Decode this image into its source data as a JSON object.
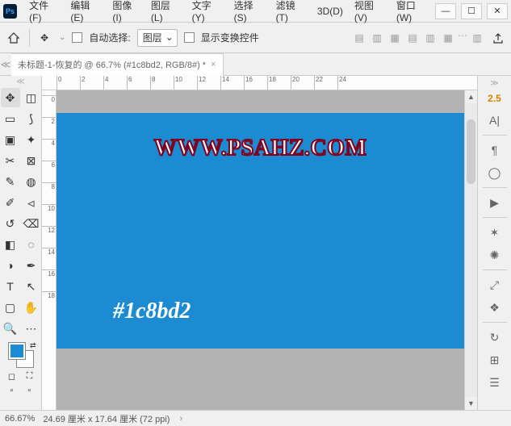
{
  "menubar": {
    "items": [
      "文件(F)",
      "编辑(E)",
      "图像(I)",
      "图层(L)",
      "文字(Y)",
      "选择(S)",
      "滤镜(T)",
      "3D(D)",
      "视图(V)",
      "窗口(W)"
    ]
  },
  "app_logo_text": "Ps",
  "options": {
    "auto_select_label": "自动选择:",
    "target_dropdown": "图层",
    "show_transform_label": "显示变换控件"
  },
  "tab": {
    "title": "未标题-1-恢复的 @ 66.7% (#1c8bd2, RGB/8#) *"
  },
  "ruler_h": [
    "0",
    "2",
    "4",
    "6",
    "8",
    "10",
    "12",
    "14",
    "16",
    "18",
    "20",
    "22",
    "24"
  ],
  "ruler_v": [
    "0",
    "2",
    "4",
    "6",
    "8",
    "10",
    "12",
    "14",
    "16",
    "18"
  ],
  "canvas": {
    "bg_color": "#1c8bd2",
    "url_text": "WWW.PSAHZ.COM",
    "color_code": "#1c8bd2"
  },
  "foreground_color": "#1c8bd2",
  "right_panel": {
    "value": "2.5"
  },
  "status": {
    "zoom": "66.67%",
    "dims": "24.69 厘米 x 17.64 厘米 (72 ppi)"
  }
}
